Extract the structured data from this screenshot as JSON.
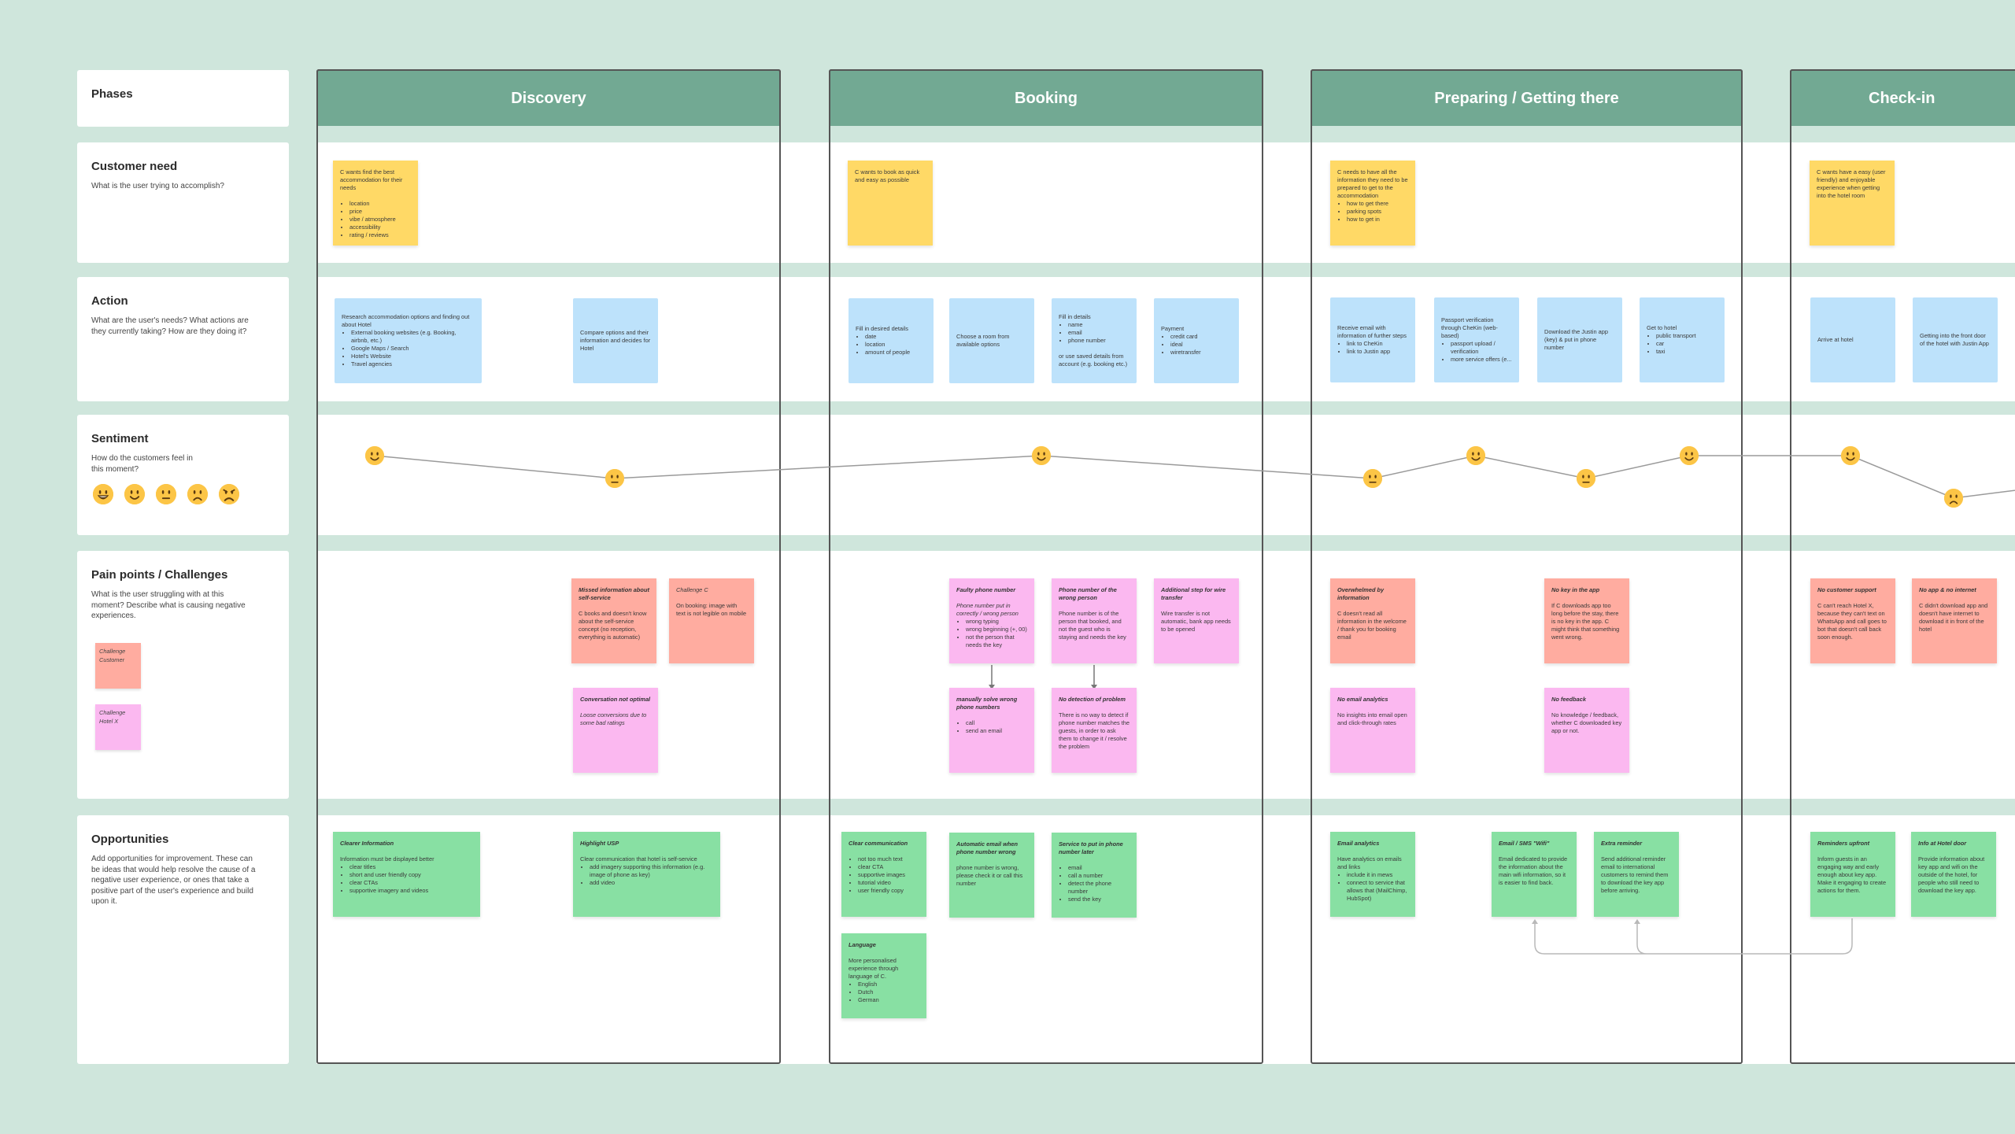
{
  "rows": {
    "phases": {
      "title": "Phases"
    },
    "customer_need": {
      "title": "Customer need",
      "desc": "What is the user trying to accomplish?"
    },
    "action": {
      "title": "Action",
      "desc": "What are the user's needs? What actions are they currently taking? How are they doing it?"
    },
    "sentiment": {
      "title": "Sentiment",
      "desc": "How do the customers feel in this moment?",
      "scale": [
        "very-happy",
        "happy",
        "neutral",
        "sad",
        "angry"
      ]
    },
    "pain_points": {
      "title": "Pain points / Challenges",
      "desc": "What is the user struggling with at this moment? Describe what is causing negative experiences.",
      "legend": [
        {
          "label": "Challenge Customer",
          "color": "#ffaca0"
        },
        {
          "label": "Challenge Hotel X",
          "color": "#fbb8f0"
        }
      ]
    },
    "opportunities": {
      "title": "Opportunities",
      "desc": "Add opportunities for improvement. These can be ideas that would help resolve the cause of a negative user experience, or ones that take a positive part of the user's experience and build upon it."
    }
  },
  "colors": {
    "background": "#cfe6dc",
    "phase_header": "#72a993",
    "customer_need": "#ffd966",
    "action": "#bde2fb",
    "challenge_customer": "#ffaca0",
    "challenge_hotel": "#fbb8f0",
    "opportunity": "#88e0a3",
    "emoji": "#fcc546"
  },
  "phases": [
    {
      "name": "Discovery"
    },
    {
      "name": "Booking"
    },
    {
      "name": "Preparing / Getting there"
    },
    {
      "name": "Check-in"
    }
  ],
  "customer_needs": [
    {
      "phase": "Discovery",
      "text": "C wants find the best accommodation for their needs",
      "items": [
        "location",
        "price",
        "vibe / atmosphere",
        "accessibility",
        "rating / reviews"
      ]
    },
    {
      "phase": "Booking",
      "text": "C wants to book as quick and easy as possible",
      "items": []
    },
    {
      "phase": "Preparing / Getting there",
      "text": "C needs to have all the information they need to be prepared to get to the accommodation",
      "items": [
        "how to get there",
        "parking spots",
        "how to get in"
      ]
    },
    {
      "phase": "Check-in",
      "text": "C wants have a easy (user friendly) and enjoyable experience when getting into the hotel room",
      "items": []
    }
  ],
  "actions": [
    {
      "phase": "Discovery",
      "text": "Research accommodation options and finding out about Hotel",
      "items": [
        "External booking websites (e.g. Booking, airbnb, etc.)",
        "Google Maps / Search",
        "Hotel's Website",
        "Travel agencies"
      ]
    },
    {
      "phase": "Discovery",
      "text": "Compare options and their information and decides for Hotel",
      "items": []
    },
    {
      "phase": "Booking",
      "text": "Fill in desired details",
      "items": [
        "date",
        "location",
        "amount of people"
      ]
    },
    {
      "phase": "Booking",
      "text": "Choose a room from available options",
      "items": []
    },
    {
      "phase": "Booking",
      "text": "Fill in details",
      "items": [
        "name",
        "email",
        "phone number"
      ],
      "after": "or use saved details from account (e.g. booking etc.)"
    },
    {
      "phase": "Booking",
      "text": "Payment",
      "items": [
        "credit card",
        "ideal",
        "wiretransfer"
      ]
    },
    {
      "phase": "Preparing / Getting there",
      "text": "Receive email with information of further steps",
      "items": [
        "link to CheKin",
        "link to Justin app"
      ]
    },
    {
      "phase": "Preparing / Getting there",
      "text": "Passport verification through CheKin (web-based)",
      "items": [
        "passport upload / verification",
        "more service offers (e..."
      ]
    },
    {
      "phase": "Preparing / Getting there",
      "text": "Download the Justin app (key) & put in phone number",
      "items": []
    },
    {
      "phase": "Preparing / Getting there",
      "text": "Get to hotel",
      "items": [
        "public transport",
        "car",
        "taxi"
      ]
    },
    {
      "phase": "Check-in",
      "text": "Arrive at hotel",
      "items": []
    },
    {
      "phase": "Check-in",
      "text": "Getting into the front door of the hotel with Justin App",
      "items": []
    }
  ],
  "sentiment_points": [
    {
      "phase": "Discovery",
      "mood": "happy",
      "level": 2
    },
    {
      "phase": "Discovery",
      "mood": "neutral",
      "level": 3
    },
    {
      "phase": "Booking",
      "mood": "happy",
      "level": 2
    },
    {
      "phase": "Preparing / Getting there",
      "mood": "neutral",
      "level": 3
    },
    {
      "phase": "Preparing / Getting there",
      "mood": "happy",
      "level": 2
    },
    {
      "phase": "Preparing / Getting there",
      "mood": "neutral",
      "level": 3
    },
    {
      "phase": "Preparing / Getting there",
      "mood": "happy",
      "level": 2
    },
    {
      "phase": "Check-in",
      "mood": "happy",
      "level": 2
    },
    {
      "phase": "Check-in",
      "mood": "sad",
      "level": 4
    }
  ],
  "pain_points": [
    {
      "phase": "Discovery",
      "type": "customer",
      "title": "Missed information about self-service",
      "body": "C books and doesn't know about the self-service concept (no reception, everything is automatic)"
    },
    {
      "phase": "Discovery",
      "type": "customer",
      "title": "Challenge C",
      "title_style": "italic",
      "body": "On booking: image with text is not legible on mobile"
    },
    {
      "phase": "Discovery",
      "type": "hotel",
      "title": "Conversation not optimal",
      "body": "Loose conversions due to some bad ratings",
      "body_style": "italic"
    },
    {
      "phase": "Booking",
      "type": "hotel",
      "title": "Faulty phone number",
      "body": "Phone number put in correctly / wrong person",
      "body_style": "italic",
      "items": [
        "wrong typing",
        "wrong beginning (+, 00)",
        "not the person that needs the key"
      ]
    },
    {
      "phase": "Booking",
      "type": "hotel",
      "title": "Phone number of the wrong person",
      "body": "Phone number is of the person that booked, and not the guest who is staying and needs the key"
    },
    {
      "phase": "Booking",
      "type": "hotel",
      "title": "Additional step for wire transfer",
      "body": "Wire transfer is not automatic, bank app needs to be opened"
    },
    {
      "phase": "Booking",
      "type": "hotel",
      "title": "manually solve wrong phone numbers",
      "body": "",
      "items": [
        "call",
        "send an email"
      ]
    },
    {
      "phase": "Booking",
      "type": "hotel",
      "title": "No detection of problem",
      "body": "There is no way to detect if phone number matches the guests, in order to ask them to change it / resolve the problem"
    },
    {
      "phase": "Preparing / Getting there",
      "type": "customer",
      "title": "Overwhelmed by information",
      "body": "C doesn't read all information in the welcome / thank you for booking email"
    },
    {
      "phase": "Preparing / Getting there",
      "type": "customer",
      "title": "No key in the app",
      "body": "If C downloads app too long before the stay, there is no key in the app. C might think that something went wrong."
    },
    {
      "phase": "Preparing / Getting there",
      "type": "hotel",
      "title": "No email analytics",
      "body": "No insights into email open and click-through rates"
    },
    {
      "phase": "Preparing / Getting there",
      "type": "hotel",
      "title": "No feedback",
      "body": "No knowledge / feedback, whether C downloaded key app or not."
    },
    {
      "phase": "Check-in",
      "type": "customer",
      "title": "No customer support",
      "body": "C can't reach Hotel X, because they can't text on WhatsApp and call goes to bot that doesn't call back soon enough."
    },
    {
      "phase": "Check-in",
      "type": "customer",
      "title": "No app & no internet",
      "body": "C didn't download app and doesn't have internet to download it in front of the hotel"
    }
  ],
  "opportunities": [
    {
      "phase": "Discovery",
      "title": "Clearer Information",
      "body": "Information must be displayed better",
      "items": [
        "clear titles",
        "short and user friendly copy",
        "clear CTAs",
        "supportive imagery and videos"
      ]
    },
    {
      "phase": "Discovery",
      "title": "Highlight USP",
      "body": "Clear communication that hotel is self-service",
      "items": [
        "add imagery supporting this information (e.g. image of phone as key)",
        "add video"
      ]
    },
    {
      "phase": "Booking",
      "title": "Clear communication",
      "body": "",
      "items": [
        "not too much text",
        "clear CTA",
        "supportive images",
        "tutorial video",
        "user friendly copy"
      ]
    },
    {
      "phase": "Booking",
      "title": "Automatic email when phone number wrong",
      "body": "phone number is wrong, please check it  or call this number",
      "items": []
    },
    {
      "phase": "Booking",
      "title": "Service to put in phone number later",
      "body": "",
      "items": [
        "email",
        "call a number",
        "detect the phone number",
        "send the key"
      ]
    },
    {
      "phase": "Booking",
      "title": "Language",
      "body": "More personalised experience through language of C.",
      "items": [
        "English",
        "Dutch",
        "German"
      ]
    },
    {
      "phase": "Preparing / Getting there",
      "title": "Email analytics",
      "body": "Have analytics on emails and links",
      "items": [
        "include it in mews",
        "connect to service that allows that (MailChimp, HubSpot)"
      ]
    },
    {
      "phase": "Preparing / Getting there",
      "title": "Email / SMS \"Wifi\"",
      "body": "Email dedicated to provide the information about the main wifi information, so it is easier to find back.",
      "items": []
    },
    {
      "phase": "Preparing / Getting there",
      "title": "Extra reminder",
      "body": "Send additional reminder email to international customers to remind them to download the key app before arriving.",
      "items": []
    },
    {
      "phase": "Check-in",
      "title": "Reminders upfront",
      "body": "Inform guests in an engaging way and early enough about key app. Make it engaging to create actions for them.",
      "items": []
    },
    {
      "phase": "Check-in",
      "title": "Info at Hotel door",
      "body": "Provide information about key app and wifi on the outside of the hotel, for people who still need to download the key app.",
      "items": []
    }
  ]
}
